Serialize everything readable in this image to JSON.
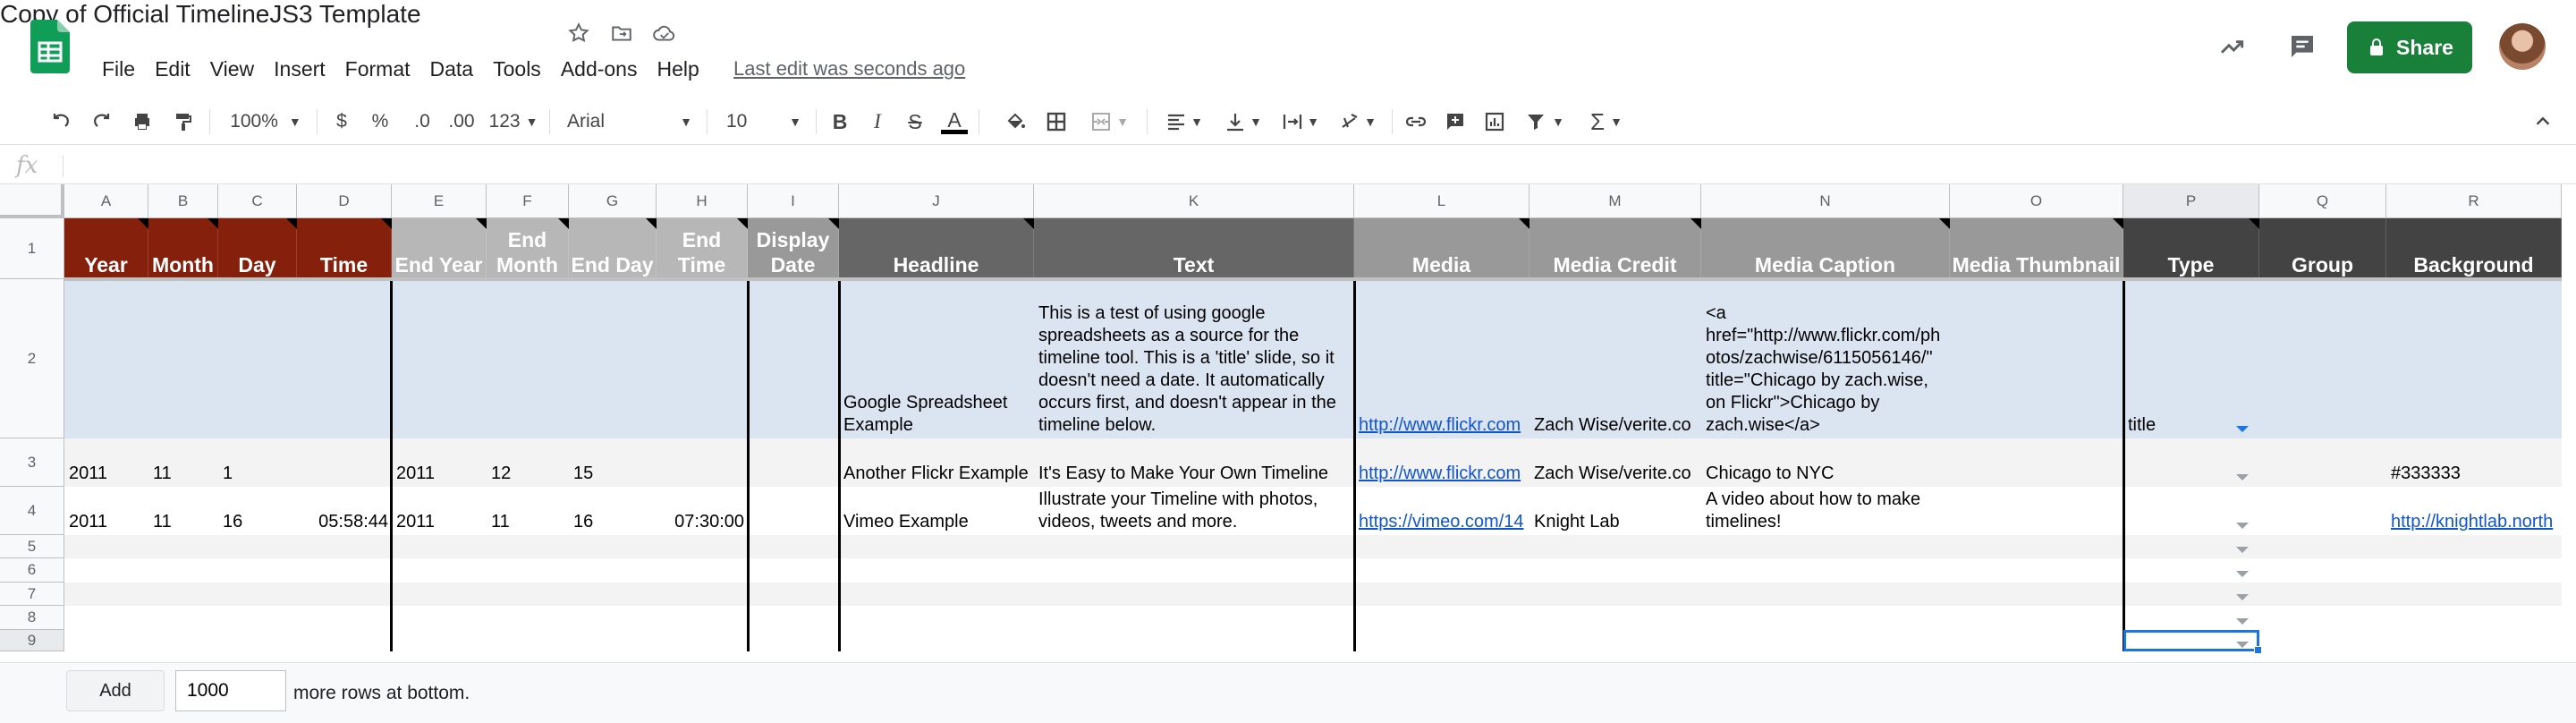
{
  "app": {
    "doc_title": "Copy of Official TimelineJS3 Template",
    "menu": [
      "File",
      "Edit",
      "View",
      "Insert",
      "Format",
      "Data",
      "Tools",
      "Add-ons",
      "Help"
    ],
    "last_edit": "Last edit was seconds ago",
    "share_label": "Share"
  },
  "toolbar": {
    "zoom": "100%",
    "currency": "$",
    "percent": "%",
    "dec_decrease": ".0",
    "dec_increase": ".00",
    "more_formats": "123",
    "font": "Arial",
    "font_size": "10",
    "bold": "B",
    "italic": "I",
    "strike": "S",
    "text_color": "A",
    "function": "Σ"
  },
  "formula_bar": {
    "fx": "fx",
    "value": ""
  },
  "columns": [
    "A",
    "B",
    "C",
    "D",
    "E",
    "F",
    "G",
    "H",
    "I",
    "J",
    "K",
    "L",
    "M",
    "N",
    "O",
    "P",
    "Q",
    "R"
  ],
  "rows": [
    "1",
    "2",
    "3",
    "4",
    "5",
    "6",
    "7",
    "8",
    "9"
  ],
  "headers": [
    "Year",
    "Month",
    "Day",
    "Time",
    "End Year",
    "End Month",
    "End Day",
    "End Time",
    "Display Date",
    "Headline",
    "Text",
    "Media",
    "Media Credit",
    "Media Caption",
    "Media Thumbnail",
    "Type",
    "Group",
    "Background"
  ],
  "row2": {
    "headline": "Google Spreadsheet Example",
    "text": "This is a test of using google spreadsheets as a source for the timeline tool. This is a 'title' slide, so it doesn't need a date. It automatically occurs first, and doesn't appear in the timeline below.",
    "media": "http://www.flickr.com",
    "credit": "Zach Wise/verite.co",
    "caption": "<a href=\"http://www.flickr.com/photos/zachwise/6115056146/\" title=\"Chicago by zach.wise, on Flickr\">Chicago by zach.wise</a>",
    "type": "title"
  },
  "row3": {
    "year": "2011",
    "month": "11",
    "day": "1",
    "end_year": "2011",
    "end_month": "12",
    "end_day": "15",
    "headline": "Another Flickr Example",
    "text": "It's Easy to Make Your Own Timeline",
    "media": "http://www.flickr.com",
    "credit": "Zach Wise/verite.co",
    "caption": "Chicago to NYC",
    "background": "#333333"
  },
  "row4": {
    "year": "2011",
    "month": "11",
    "day": "16",
    "time": "05:58:44",
    "end_year": "2011",
    "end_month": "11",
    "end_day": "16",
    "end_time": "07:30:00",
    "headline": "Vimeo Example",
    "text": "Illustrate your Timeline with photos, videos, tweets and more.",
    "media": "https://vimeo.com/14",
    "credit": "Knight Lab",
    "caption": "A video about how to make timelines!",
    "background": "http://knightlab.north"
  },
  "bottom": {
    "add_label": "Add",
    "rows_value": "1000",
    "more_rows": "more rows at bottom."
  },
  "colors": {
    "date_header": "#85200c",
    "enddate_header": "#b7b7b7",
    "dark_header": "#666666",
    "media_header": "#999999",
    "type_header": "#434343",
    "title_row": "#dbe5f1",
    "share": "#188038"
  }
}
